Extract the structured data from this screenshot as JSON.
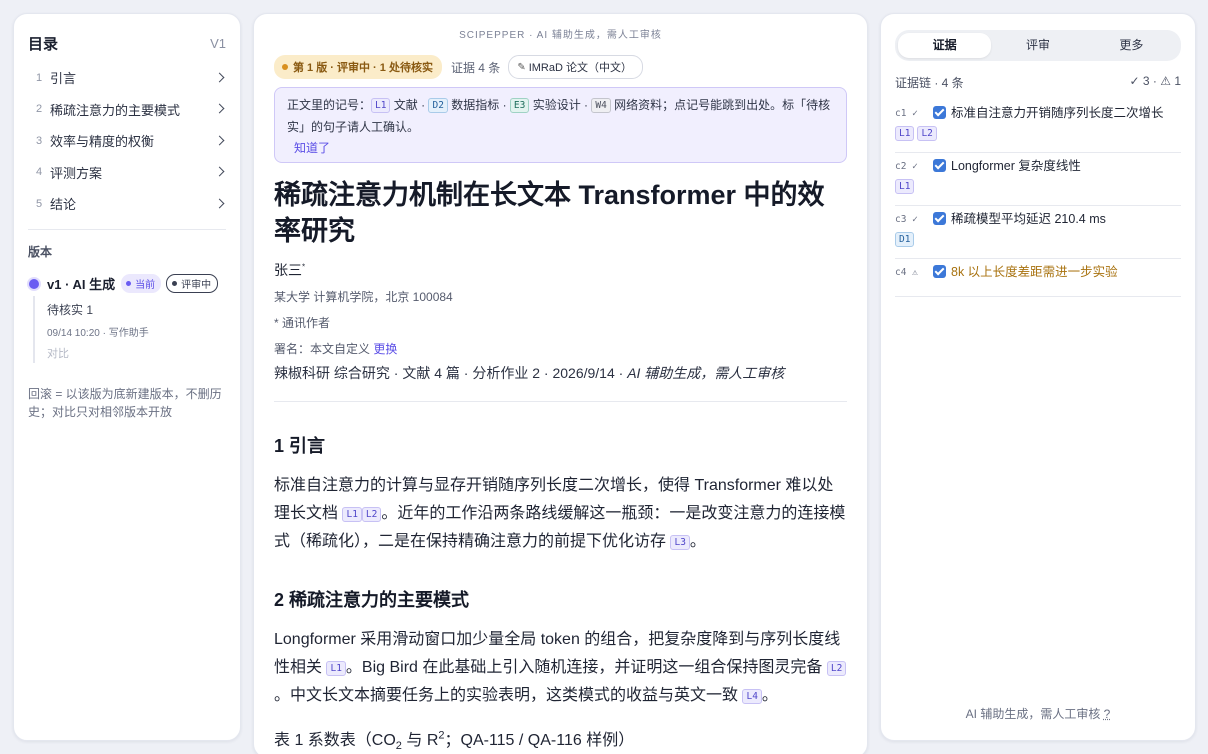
{
  "toc": {
    "title": "目录",
    "version": "V1",
    "items": [
      {
        "num": "1",
        "label": "引言"
      },
      {
        "num": "2",
        "label": "稀疏注意力的主要模式"
      },
      {
        "num": "3",
        "label": "效率与精度的权衡"
      },
      {
        "num": "4",
        "label": "评测方案"
      },
      {
        "num": "5",
        "label": "结论"
      }
    ]
  },
  "versions": {
    "section_label": "版本",
    "current": {
      "name": "v1 · AI 生成",
      "badge_current": "当前",
      "badge_status": "评审中",
      "pending": "待核实 1",
      "meta": "09/14 10:20 · 写作助手",
      "compare": "对比"
    },
    "rollback_note": "回滚 = 以该版为底新建版本，不删历史；对比只对相邻版本开放"
  },
  "doc": {
    "brand": "SCIPEPPER · AI 辅助生成，需人工审核",
    "status": "第 1 版 · 评审中 · 1 处待核实",
    "evidence_count": "证据 4 条",
    "format": "IMRaD 论文（中文）",
    "info": {
      "p1": "正文里的记号：",
      "t1": "L1",
      "p2": " 文献 · ",
      "t2": "D2",
      "p3": " 数据指标 · ",
      "t3": "E3",
      "p4": " 实验设计 · ",
      "t4": "W4",
      "p5": " 网络资料；点记号能跳到出处。标「待核实」的句子请人工确认。",
      "ack": "知道了"
    },
    "title": "稀疏注意力机制在长文本 Transformer 中的效率研究",
    "author": "张三",
    "author_mark": "*",
    "affiliation": "某大学 计算机学院，北京 100084",
    "corresponding": "* 通讯作者",
    "signature_prefix": "署名：本文自定义 ",
    "signature_link": "更换",
    "meta_line": "辣椒科研 综合研究 · 文献 4 篇 · 分析作业 2 · 2026/9/14 · ",
    "meta_italic": "AI 辅助生成，需人工审核",
    "sec1": {
      "heading": "1 引言",
      "s1": "标准自注意力的计算与显存开销随序列长度二次增长，使得 Transformer 难以处理长文档",
      "t1": "L1",
      "t2": "L2",
      "s2": "。近年的工作沿两条路线缓解这一瓶颈：一是改变注意力的连接模式（稀疏化），二是在保持精确注意力的前提下优化访存",
      "t3": "L3",
      "s3": "。"
    },
    "sec2": {
      "heading": "2 稀疏注意力的主要模式",
      "s1": "Longformer 采用滑动窗口加少量全局 token 的组合，把复杂度降到与序列长度线性相关",
      "t1": "L1",
      "s2": "。Big Bird 在此基础上引入随机连接，并证明这一组合保持图灵完备",
      "t2": "L2",
      "s3": "。中文长文本摘要任务上的实验表明，这类模式的收益与英文一致",
      "t3": "L4",
      "s4": "。"
    },
    "table_caption": {
      "p1": "表 1 系数表（CO",
      "sub": "2",
      "p2": " 与 R",
      "sup": "2",
      "p3": "；QA-115 / QA-116 样例）"
    }
  },
  "panel": {
    "tabs": [
      "证据",
      "评审",
      "更多"
    ],
    "chain_label": "证据链 · 4 条",
    "chain_stats": "✓ 3 · ⚠ 1",
    "claims": [
      {
        "id": "c1 ✓",
        "text": "标准自注意力开销随序列长度二次增长",
        "tags": [
          "L1",
          "L2"
        ]
      },
      {
        "id": "c2 ✓",
        "text": "Longformer 复杂度线性",
        "tags": [
          "L1"
        ]
      },
      {
        "id": "c3 ✓",
        "text": "稀疏模型平均延迟 210.4 ms",
        "tags": [
          "D1"
        ]
      },
      {
        "id": "c4 ⚠",
        "text": "8k 以上长度差距需进一步实验",
        "tags": []
      }
    ],
    "footer": "AI 辅助生成，需人工审核",
    "footer_q": "?"
  },
  "colors": {
    "accent": "#5b4ee6",
    "warn": "#a8720f",
    "checkbox": "#3c78d8"
  }
}
